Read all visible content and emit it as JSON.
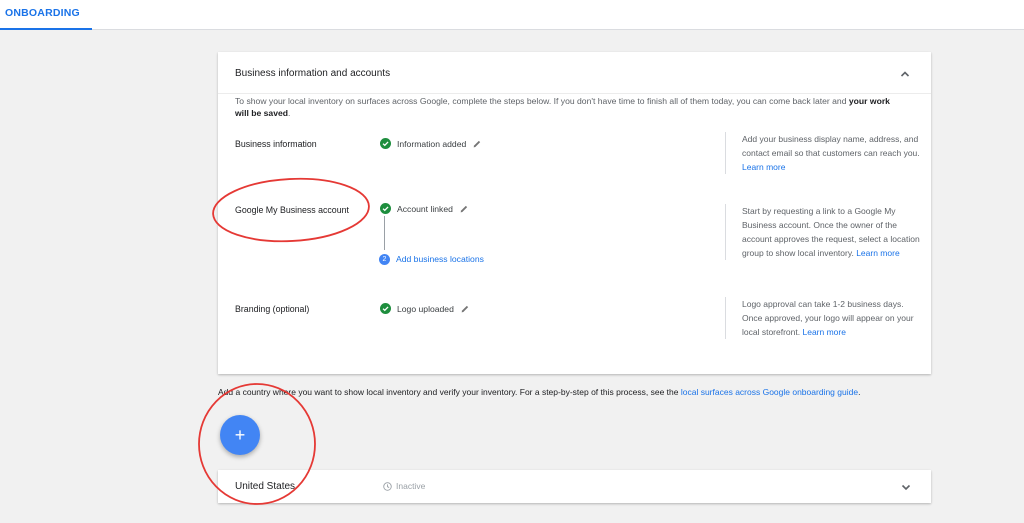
{
  "topbar": {
    "tab_label": "ONBOARDING"
  },
  "card": {
    "title": "Business information and accounts",
    "intro_text": "To show your local inventory on surfaces across Google, complete the steps below. If you don't have time to finish all of them today, you can come back later and ",
    "intro_bold": "your work will be saved",
    "intro_end": ".",
    "rows": [
      {
        "label": "Business information",
        "status": "Information added",
        "helper": "Add your business display name, address, and contact email so that customers can reach you.",
        "helper_link": "Learn more"
      },
      {
        "label": "Google My Business account",
        "status": "Account linked",
        "sub_step_number": "2",
        "sub_step_link": "Add business locations",
        "helper": "Start by requesting a link to a Google My Business account. Once the owner of the account approves the request, select a location group to show local inventory.",
        "helper_link": "Learn more"
      },
      {
        "label": "Branding (optional)",
        "status": "Logo uploaded",
        "helper": "Logo approval can take 1-2 business days. Once approved, your logo will appear on your local storefront.",
        "helper_link": "Learn more"
      }
    ]
  },
  "country_section": {
    "intro_text": "Add a country where you want to show local inventory and verify your inventory. For a step-by-step of this process, see the ",
    "intro_link": "local surfaces across Google onboarding guide",
    "intro_end": ".",
    "fab_label": "+",
    "countries": [
      {
        "name": "United States",
        "status": "Inactive"
      }
    ]
  },
  "colors": {
    "accent": "#1a73e8",
    "success": "#1e8e3e",
    "fab": "#4285f4",
    "annotation": "#e53935"
  }
}
